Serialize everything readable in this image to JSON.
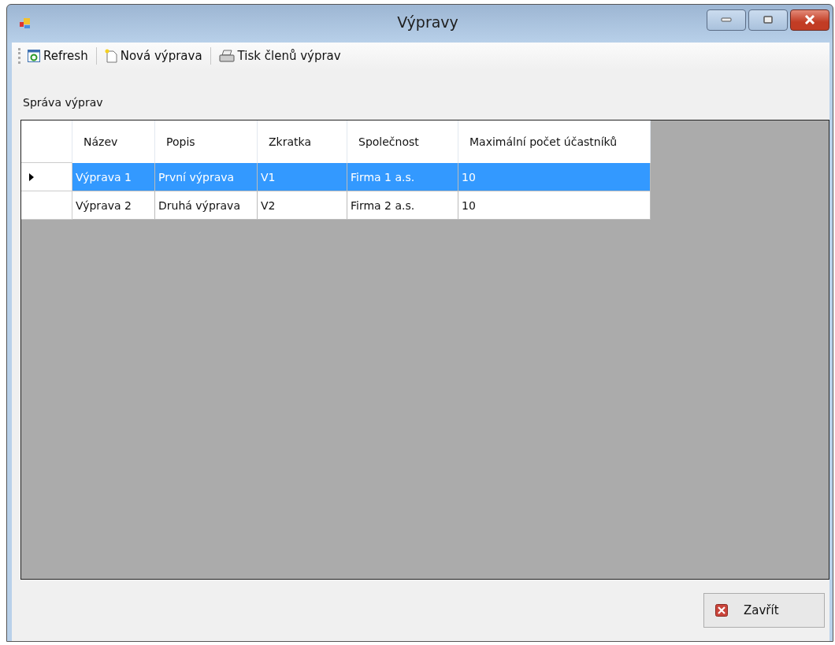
{
  "window": {
    "title": "Výpravy"
  },
  "toolbar": [
    {
      "kind": "refresh",
      "label": "Refresh"
    },
    {
      "kind": "new",
      "label": "Nová výprava"
    },
    {
      "kind": "print",
      "label": "Tisk členů výprav"
    }
  ],
  "section_label": "Správa výprav",
  "table": {
    "columns": [
      "Název",
      "Popis",
      "Zkratka",
      "Společnost",
      "Maximální počet účastníků"
    ],
    "rows": [
      {
        "selected": true,
        "cells": [
          "Výprava 1",
          "První výprava",
          "V1",
          "Firma 1 a.s.",
          "10"
        ]
      },
      {
        "selected": false,
        "cells": [
          "Výprava 2",
          "Druhá výprava",
          "V2",
          "Firma 2 a.s.",
          "10"
        ]
      }
    ]
  },
  "buttons": [
    {
      "kind": "close",
      "label": "Zavřít"
    }
  ]
}
